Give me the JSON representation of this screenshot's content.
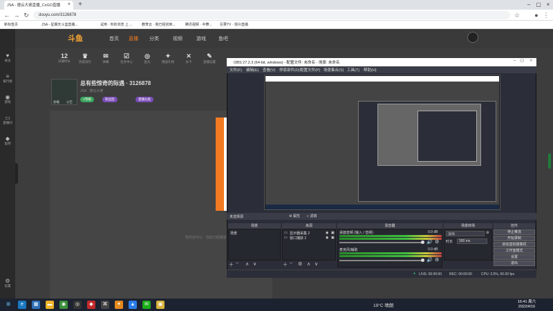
{
  "browser": {
    "tab_title": "JSA - 德云大佬直播_CsGO直播",
    "url": "douyu.com/3126878",
    "bookmarks": [
      "新标签页",
      "JSA - 星期天斗篮直播...",
      "试用 · 你的浏览 上 ...",
      "教育云 · 我已经找到...",
      "腾讯视频 · 中華...",
      "巨果TV · 观众直播"
    ]
  },
  "site": {
    "logo": "斗鱼",
    "nav": [
      "首页",
      "直播",
      "分类",
      "视频",
      "游戏",
      "鱼吧"
    ],
    "tool_count": "12",
    "tools": [
      "日播时长",
      "热度排行",
      "弹幕",
      "任务中心",
      "鱼丸",
      "赠送礼物",
      "办卡",
      "直播设置"
    ],
    "room_title": "总有些惊奇的际遇 · 3126878",
    "room_sub": "JSA · 德云大佬",
    "streamer_name": "加载",
    "streamer_tag": "公告",
    "pills": [
      "V等级",
      "粉丝团",
      "直播分类"
    ],
    "bottom_text": "暂时还可以 · 当前已经播放的直播内容",
    "rail": [
      "关注",
      "排行榜",
      "游戏",
      "直播间",
      "鱼吧",
      "设置"
    ]
  },
  "obs": {
    "title": "OBS 27.2.3 (64-bit, windows) - 配置文件: 未命名 - 场景: 未命名",
    "menu": [
      "文件(F)",
      "编辑(E)",
      "查看(V)",
      "停靠部件(D)",
      "配置文件(P)",
      "场景集合(S)",
      "工具(T)",
      "帮助(H)"
    ],
    "no_source": "未选择源",
    "prop_btn": "属性",
    "filter_btn": "滤镜",
    "scenes_title": "场景",
    "scenes": [
      "场景"
    ],
    "sources_title": "来源",
    "sources": [
      "显示器采集 2",
      "窗口捕获 2"
    ],
    "mixer_title": "混音器",
    "mixer": [
      {
        "name": "桌面音频 (输入 / 音频)",
        "db": "0.0 dB"
      },
      {
        "name": "麦克风/辅助",
        "db": "0.0 dB"
      }
    ],
    "transition_title": "场景转场",
    "transition": "淡出",
    "duration_label": "时长",
    "duration": "300 ms",
    "controls_title": "控件",
    "controls": [
      "停止推流",
      "开始录制",
      "启动虚拟摄像机",
      "工作室模式",
      "设置",
      "退出"
    ],
    "status": {
      "live": "LIVE: 00:00:00",
      "rec": "REC: 00:00:00",
      "cpu": "CPU: 3.5%, 60.00 fps"
    }
  },
  "taskbar": {
    "weather": "19°C 晴朗",
    "time": "16:41 周六",
    "date": "2022/4/16"
  }
}
